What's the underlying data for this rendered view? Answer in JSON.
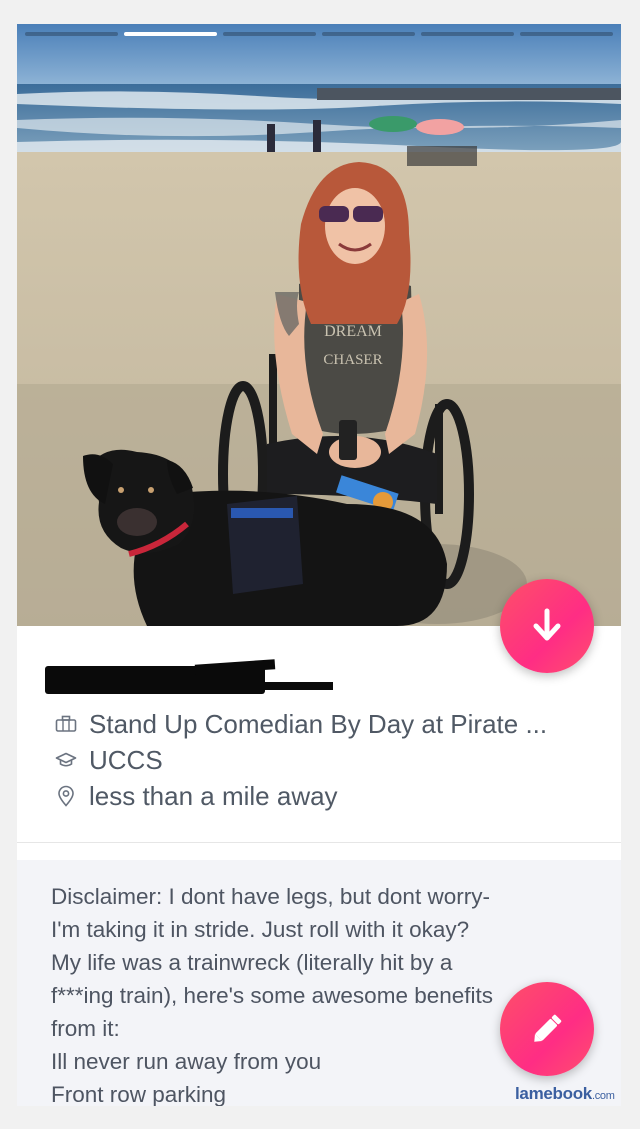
{
  "profile": {
    "job": "Stand Up Comedian By Day at Pirate ...",
    "school": "UCCS",
    "distance": "less than a mile away"
  },
  "bio": {
    "lines": [
      "Disclaimer: I dont have legs, but dont worry-",
      "I'm taking it in stride. Just roll with it okay?",
      "My life was a trainwreck (literally hit by a",
      "f***ing train), here's some awesome benefits",
      "from it:",
      "Ill never run away from you",
      "Front row parking"
    ]
  },
  "photo": {
    "shirt_text_1": "DREAM",
    "shirt_text_2": "CHASER",
    "photo_count": 6,
    "active_index": 1
  },
  "icons": {
    "info": "arrow-down-icon",
    "edit": "pencil-icon",
    "job": "briefcase-icon",
    "school": "graduation-cap-icon",
    "location": "location-pin-icon"
  },
  "colors": {
    "accent_start": "#fd5068",
    "accent_end": "#ff2d84",
    "text": "#505965",
    "bio_bg": "#f3f4f8"
  },
  "watermark": {
    "brand": "lamebook",
    "suffix": ".com"
  }
}
